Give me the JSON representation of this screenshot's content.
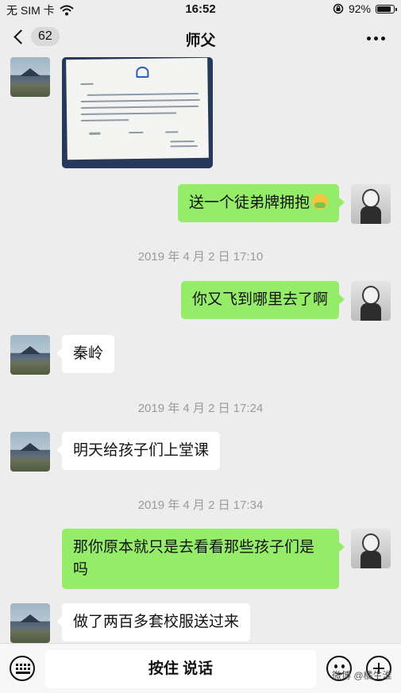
{
  "status_bar": {
    "carrier": "无 SIM 卡",
    "time": "16:52",
    "battery": "92%",
    "battery_level": 0.92,
    "icons": [
      "wifi-icon",
      "rotation-lock-icon",
      "battery-icon"
    ]
  },
  "nav": {
    "unread_count": "62",
    "title": "师父",
    "icons": [
      "back-chevron-icon",
      "more-dots-icon"
    ]
  },
  "messages": [
    {
      "side": "in",
      "type": "image",
      "text": ""
    },
    {
      "side": "out",
      "type": "text",
      "text": "送一个徒弟牌拥抱",
      "emoji": "hug-emoji"
    },
    {
      "type": "time",
      "text": "2019 年 4 月 2 日 17:10"
    },
    {
      "side": "out",
      "type": "text",
      "text": "你又飞到哪里去了啊"
    },
    {
      "side": "in",
      "type": "text",
      "text": "秦岭"
    },
    {
      "type": "time",
      "text": "2019 年 4 月 2 日 17:24"
    },
    {
      "side": "in",
      "type": "text",
      "text": "明天给孩子们上堂课"
    },
    {
      "type": "time",
      "text": "2019 年 4 月 2 日 17:34"
    },
    {
      "side": "out",
      "type": "text",
      "text": "那你原本就只是去看看那些孩子们是吗"
    },
    {
      "side": "in",
      "type": "text",
      "text": "做了两百多套校服送过来"
    }
  ],
  "input_bar": {
    "talk_label": "按住 说话",
    "icons": [
      "keyboard-icon",
      "emoji-icon",
      "plus-icon"
    ]
  },
  "watermark": "微博 @橘生淮"
}
